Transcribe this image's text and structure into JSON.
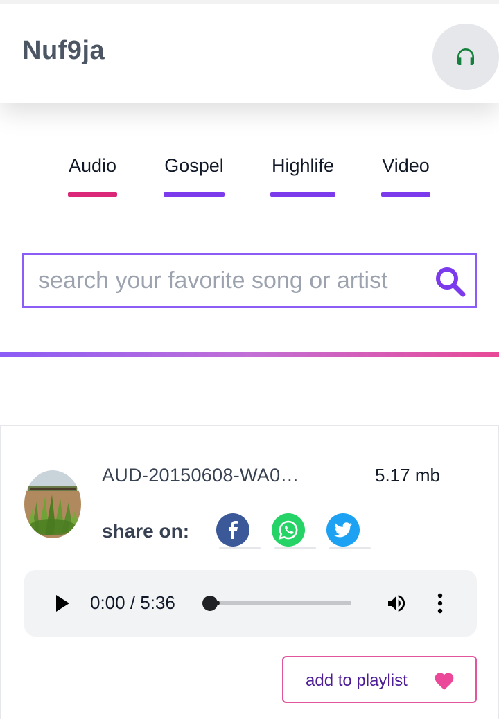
{
  "header": {
    "brand": "Nuf9ja",
    "headphones_color": "#15803d"
  },
  "nav": {
    "tabs": [
      {
        "label": "Audio",
        "color": "#db2777",
        "active": true
      },
      {
        "label": "Gospel",
        "color": "#7c3aed"
      },
      {
        "label": "Highlife",
        "color": "#7c3aed"
      },
      {
        "label": "Video",
        "color": "#7c3aed"
      }
    ]
  },
  "search": {
    "placeholder": "search your favorite song or artist",
    "icon_color": "#7c3aed"
  },
  "track": {
    "file_name": "AUD-20150608-WA0…",
    "file_size": "5.17 mb",
    "share_label": "share on:",
    "share_targets": [
      {
        "name": "facebook",
        "color": "#3b5998"
      },
      {
        "name": "whatsapp",
        "color": "#25d366"
      },
      {
        "name": "twitter",
        "color": "#1da1f2"
      }
    ],
    "player": {
      "current_time": "0:00",
      "separator": " / ",
      "duration": "5:36",
      "progress": 0.02
    },
    "add_to_playlist_label": "add to playlist",
    "heart_color": "#ec4899"
  }
}
